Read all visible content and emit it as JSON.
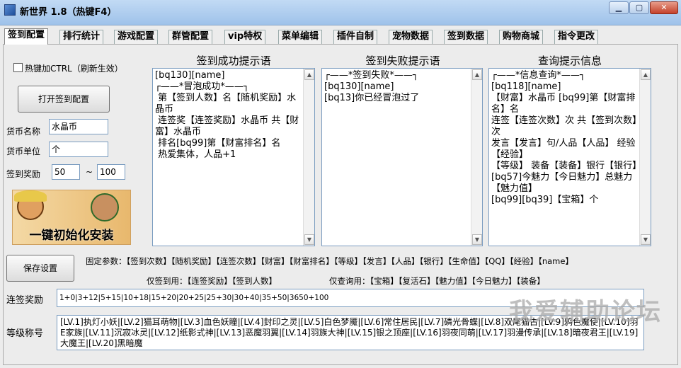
{
  "window": {
    "title": "新世界 1.8（热键F4）",
    "min_label": "▁",
    "max_label": "▢",
    "close_label": "✕"
  },
  "tabs": [
    "签到配置",
    "排行统计",
    "游戏配置",
    "群管配置",
    "vip特权",
    "菜单编辑",
    "插件自制",
    "宠物数据",
    "签到数据",
    "购物商城",
    "指令更改"
  ],
  "left": {
    "hotkey_label": "热键加CTRL（刷新生效）",
    "open_button": "打开签到配置",
    "currency_name_label": "货币名称",
    "currency_name_value": "水晶币",
    "currency_unit_label": "货币单位",
    "currency_unit_value": "个",
    "reward_label": "签到奖励",
    "reward_min": "50",
    "reward_sep": "~",
    "reward_max": "100",
    "banner_text": "一键初始化安装",
    "save_button": "保存设置"
  },
  "success": {
    "title": "签到成功提示语",
    "lines": [
      "[bq130][name]",
      "┌——*冒泡成功*——┐",
      " 第【签到人数】名【随机奖励】水晶币",
      " 连签奖【连签奖励】水晶币 共【财富】水晶币",
      " 排名[bq99]第【财富排名】名",
      " 热爱集体，人品+1"
    ]
  },
  "fail": {
    "title": "签到失败提示语",
    "lines": [
      "┌——*签到失败*——┐",
      "[bq130][name]",
      "[bq13]你已经冒泡过了"
    ]
  },
  "query": {
    "title": "查询提示信息",
    "lines": [
      "┌——*信息查询*——┐",
      "[bq118][name]",
      "【财富】水晶币 [bq99]第【财富排名】名",
      "连签【连签次数】次 共【签到次数】次",
      "发言【发言】句/人品【人品】 经验【经验】",
      "【等级】 装备【装备】银行【银行】",
      "[bq57]今魅力【今日魅力】总魅力【魅力值】",
      "[bq99][bq39]【宝箱】个"
    ]
  },
  "params": {
    "fixed_label": "固定参数：",
    "fixed": "【签到次数】【随机奖励】【连签次数】【财富】【财富排名】【等级】【发言】【人品】【银行】【生命值】【QQ】【经验】【name】",
    "signin_label": "仅签到用：",
    "signin": "【连签奖励】【签到人数】",
    "query_label": "仅查询用：",
    "query": "【宝箱】【复活石】【魅力值】【今日魅力】【装备】"
  },
  "streak": {
    "label": "连签奖励",
    "value": "1+0|3+12|5+15|10+18|15+20|20+25|25+30|30+40|35+50|3650+100"
  },
  "levels": {
    "label": "等级称号",
    "value": "[LV.1]执灯小妖|[LV.2]猫耳萌物|[LV.3]血色妖瞳|[LV.4]封印之灵|[LV.5]白色梦魇|[LV.6]常住居民|[LV.7]磷光骨蝶|[LV.8]双尾猫古|[LV.9]鸦色魔使|[LV.10]羽E家族|[LV.11]沉寂冰灵|[LV.12]纸影式神|[LV.13]恶魔羽翼|[LV.14]羽族大神|[LV.15]银之顶座|[LV.16]羽夜同萌|[LV.17]羽漫传承|[LV.18]暗夜君王|[LV.19]大魔王|[LV.20]黑暗魔"
  },
  "watermark": "我爱辅助论坛"
}
